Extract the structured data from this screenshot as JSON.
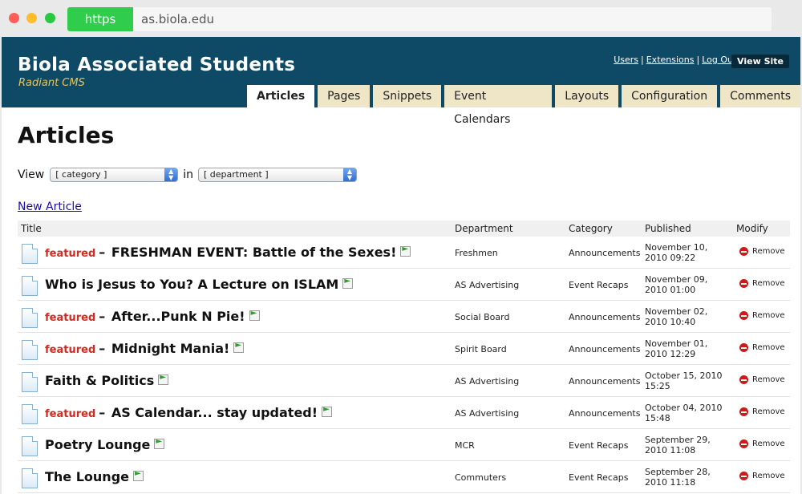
{
  "browser": {
    "scheme": "https",
    "url": "as.biola.edu"
  },
  "header": {
    "title": "Biola Associated Students",
    "subtitle": "Radiant CMS",
    "links": [
      "Users",
      "Extensions",
      "Log Out"
    ],
    "view_site": "View Site"
  },
  "tabs": [
    "Articles",
    "Pages",
    "Snippets",
    "Event Calendars",
    "Layouts",
    "Configuration",
    "Comments"
  ],
  "page": {
    "heading": "Articles",
    "view_label": "View",
    "in_label": "in",
    "category_select": "[ category ]",
    "department_select": "[ department ]",
    "new_article": "New Article"
  },
  "table": {
    "columns": [
      "Title",
      "Department",
      "Category",
      "Published",
      "Modify"
    ],
    "featured_label": "featured",
    "remove_label": "Remove",
    "rows": [
      {
        "featured": true,
        "title": "FRESHMAN EVENT: Battle of the Sexes!",
        "department": "Freshmen",
        "category": "Announcements",
        "published_1": "November 10,",
        "published_2": "2010 09:22"
      },
      {
        "featured": false,
        "title": "Who is Jesus to You? A Lecture on ISLAM",
        "department": "AS Advertising",
        "category": "Event Recaps",
        "published_1": "November 09,",
        "published_2": "2010 01:00"
      },
      {
        "featured": true,
        "title": "After...Punk N Pie!",
        "department": "Social Board",
        "category": "Announcements",
        "published_1": "November 02,",
        "published_2": "2010 10:40"
      },
      {
        "featured": true,
        "title": "Midnight Mania!",
        "department": "Spirit Board",
        "category": "Announcements",
        "published_1": "November 01,",
        "published_2": "2010 12:29"
      },
      {
        "featured": false,
        "title": "Faith & Politics",
        "department": "AS Advertising",
        "category": "Announcements",
        "published_1": "October 15, 2010",
        "published_2": "15:25"
      },
      {
        "featured": true,
        "title": "AS Calendar... stay updated!",
        "department": "AS Advertising",
        "category": "Announcements",
        "published_1": "October 04, 2010",
        "published_2": "15:48"
      },
      {
        "featured": false,
        "title": "Poetry Lounge",
        "department": "MCR",
        "category": "Event Recaps",
        "published_1": "September 29,",
        "published_2": "2010 11:08"
      },
      {
        "featured": false,
        "title": "The Lounge",
        "department": "Commuters",
        "category": "Event Recaps",
        "published_1": "September 28,",
        "published_2": "2010 11:18"
      }
    ]
  }
}
